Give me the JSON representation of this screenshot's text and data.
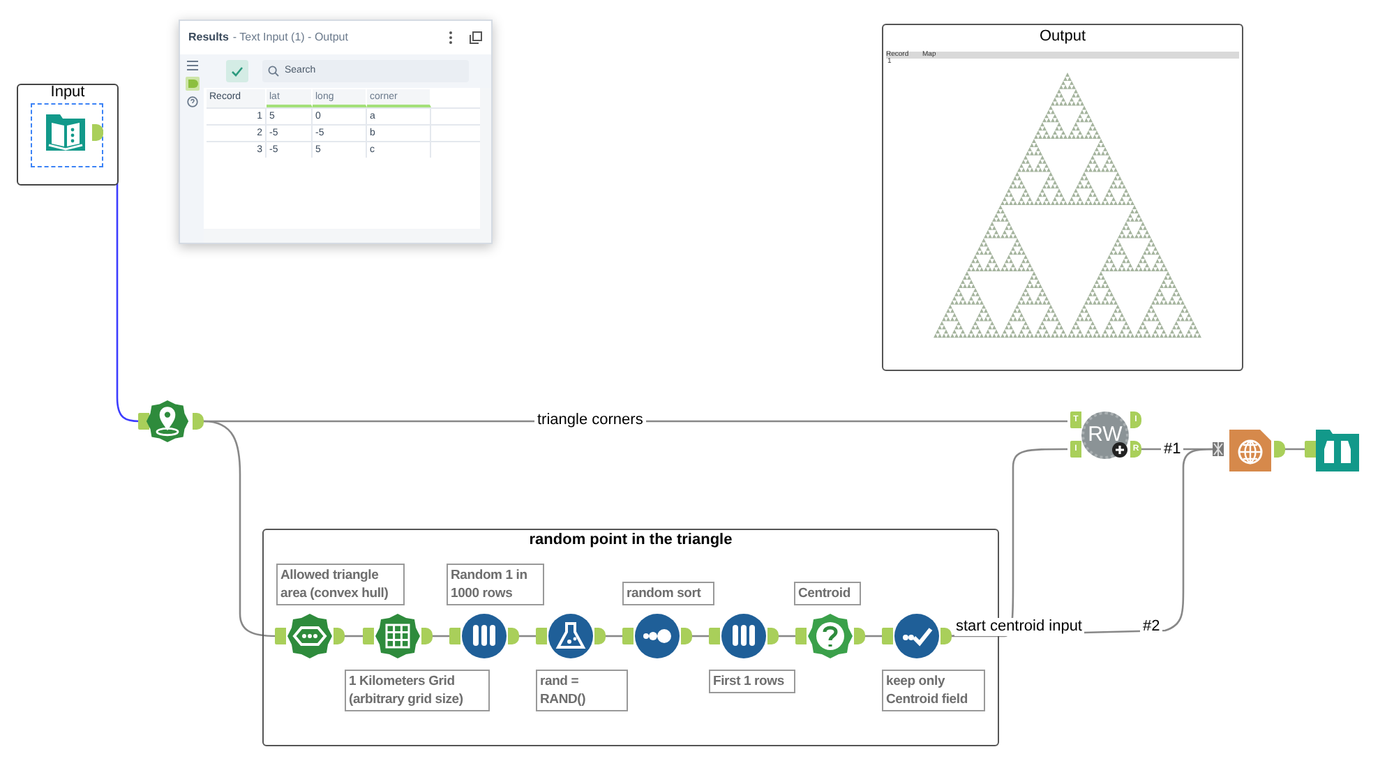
{
  "results_window": {
    "title": "Results",
    "subtitle": "- Text Input (1) - Output",
    "search": {
      "placeholder": "Search"
    },
    "table": {
      "columns": [
        "Record",
        "lat",
        "long",
        "corner"
      ],
      "rows": [
        [
          "1",
          "5",
          "0",
          "a"
        ],
        [
          "2",
          "-5",
          "-5",
          "b"
        ],
        [
          "3",
          "-5",
          "5",
          "c"
        ]
      ]
    }
  },
  "output_window": {
    "title": "Output",
    "columns": [
      "Record",
      "Map"
    ],
    "rows": [
      [
        "1"
      ]
    ]
  },
  "workflow": {
    "input_container": {
      "title": "Input"
    },
    "wire_labels": [
      "triangle corners",
      "#1",
      "start centroid input",
      "#2"
    ],
    "rw_tool": {
      "text": "RW",
      "ports": [
        "T",
        "I",
        "I",
        "R"
      ]
    },
    "container": {
      "title": "random point in the triangle",
      "tools": [
        {
          "kind": "hull",
          "annotation": "Allowed triangle area (convex hull)"
        },
        {
          "kind": "grid",
          "annotation": "1 Kilometers Grid (arbitrary grid size)"
        },
        {
          "kind": "sample",
          "annotation": "Random 1 in 1000 rows"
        },
        {
          "kind": "formula",
          "annotation": "rand = RAND()"
        },
        {
          "kind": "sort",
          "annotation": "random sort"
        },
        {
          "kind": "sample",
          "annotation": "First 1 rows"
        },
        {
          "kind": "centroid",
          "annotation": "Centroid"
        },
        {
          "kind": "select",
          "annotation": "keep only Centroid field"
        }
      ]
    }
  }
}
